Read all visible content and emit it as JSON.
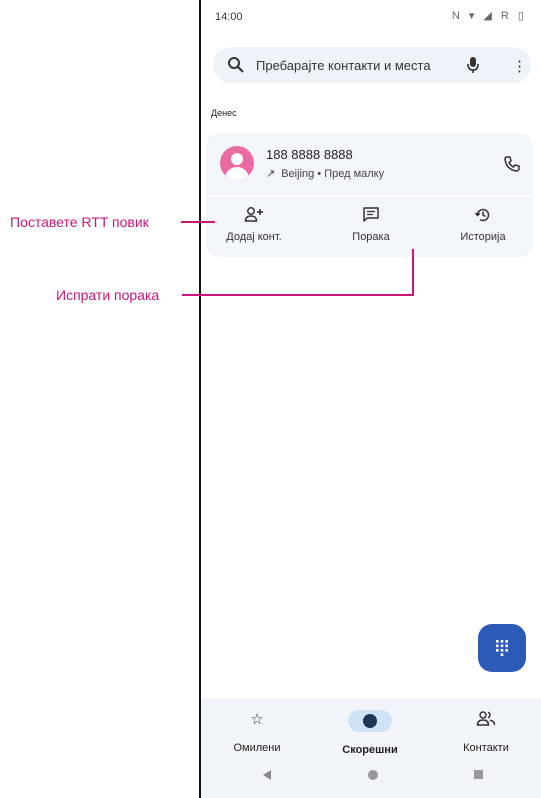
{
  "status_bar": {
    "time": "14:00",
    "icons": "N ▾ ◢ R ▯"
  },
  "search": {
    "placeholder": "Пребарајте контакти и места"
  },
  "section_header": "Денес",
  "recent_call": {
    "number": "188 8888 8888",
    "location": "Beijing • Пред малку",
    "avatar_color": "#ec6aa2",
    "actions": [
      {
        "label": "Додај конт.",
        "icon": "add-person-icon"
      },
      {
        "label": "Порака",
        "icon": "message-icon"
      },
      {
        "label": "Историја",
        "icon": "history-icon"
      }
    ]
  },
  "fab": {
    "icon": "dialpad-icon",
    "color": "#2b5bb7"
  },
  "bottom_nav": [
    {
      "label": "Омилени",
      "icon": "star-icon"
    },
    {
      "label": "Скорешни",
      "icon": "clock-icon",
      "active": true
    },
    {
      "label": "Контакти",
      "icon": "contacts-icon"
    }
  ],
  "callouts": {
    "rtt": "Поставете RTT повик",
    "message": "Испрати порака",
    "color": "#c8177a"
  }
}
